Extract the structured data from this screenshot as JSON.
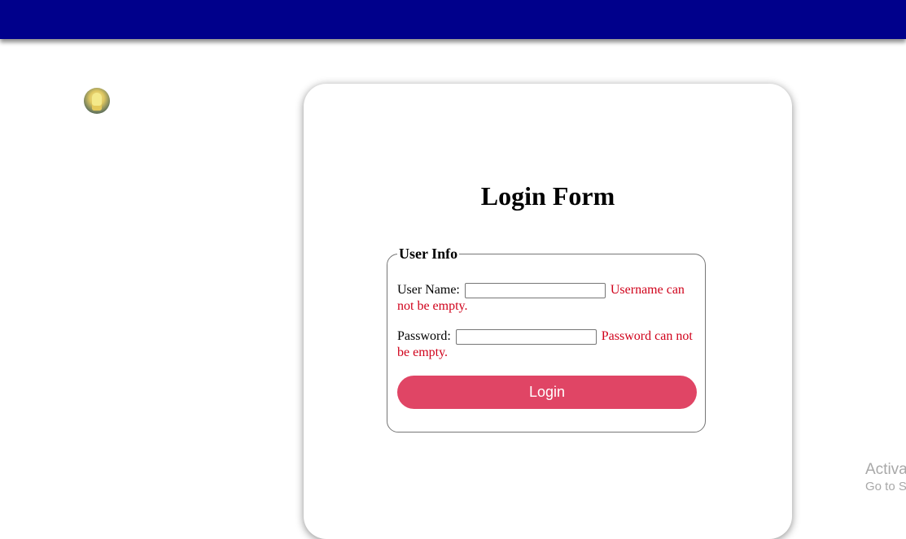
{
  "header": {
    "background": "#00008b"
  },
  "avatar": {
    "icon": "user-avatar-icon"
  },
  "login_card": {
    "title": "Login Form",
    "fieldset": {
      "legend": "User Info",
      "username": {
        "label": "User Name:",
        "value": "",
        "error": "Username can not be empty."
      },
      "password": {
        "label": "Password:",
        "value": "",
        "error": "Password can not be empty."
      },
      "login_button": "Login"
    }
  },
  "watermark": {
    "line1": "Activa",
    "line2": "Go to S"
  },
  "colors": {
    "accent": "#e04565",
    "error": "#d0021b"
  }
}
